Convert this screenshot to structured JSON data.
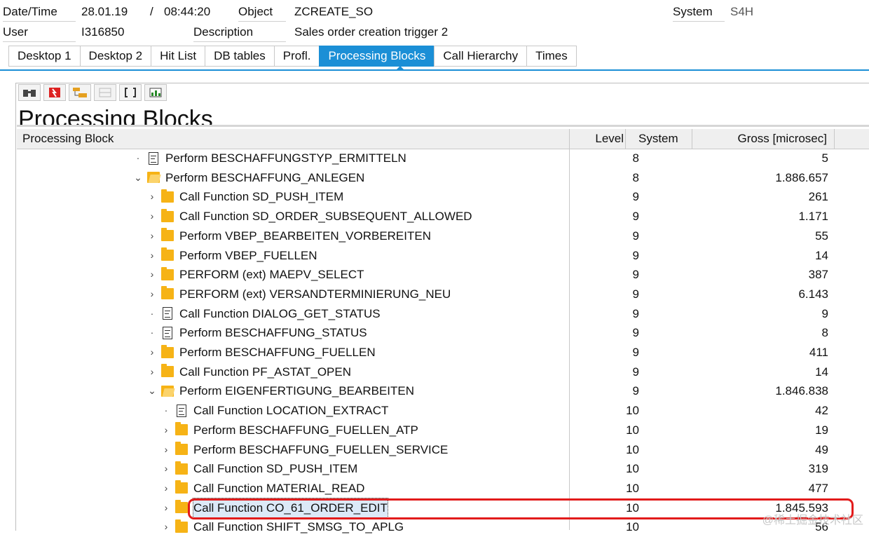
{
  "header": {
    "datetime_label": "Date/Time",
    "date": "28.01.19",
    "slash": "/",
    "time": "08:44:20",
    "object_label": "Object",
    "object": "ZCREATE_SO",
    "system_label": "System",
    "system": "S4H",
    "user_label": "User",
    "user": "I316850",
    "description_label": "Description",
    "description": "Sales order creation trigger 2"
  },
  "tabs": [
    "Desktop 1",
    "Desktop 2",
    "Hit List",
    "DB tables",
    "Profl.",
    "Processing Blocks",
    "Call Hierarchy",
    "Times"
  ],
  "active_tab": "Processing Blocks",
  "toolbar": {
    "icons": [
      "binoculars-icon",
      "delete-icon",
      "hierarchy-icon",
      "layout-icon",
      "bracket-icon",
      "chart-icon"
    ]
  },
  "panel_title": "Processing Blocks",
  "columns": {
    "block": "Processing Block",
    "level": "Level",
    "system": "System",
    "gross": "Gross [microsec]"
  },
  "rows": [
    {
      "indent": 0,
      "expander": "·",
      "icon": "doc",
      "label": "Perform BESCHAFFUNGSTYP_ERMITTELN",
      "level": "8",
      "gross": "5"
    },
    {
      "indent": 0,
      "expander": "⌄",
      "icon": "folder-open",
      "label": "Perform BESCHAFFUNG_ANLEGEN",
      "level": "8",
      "gross": "1.886.657"
    },
    {
      "indent": 1,
      "expander": "›",
      "icon": "folder",
      "label": "Call Function SD_PUSH_ITEM",
      "level": "9",
      "gross": "261"
    },
    {
      "indent": 1,
      "expander": "›",
      "icon": "folder",
      "label": "Call Function SD_ORDER_SUBSEQUENT_ALLOWED",
      "level": "9",
      "gross": "1.171"
    },
    {
      "indent": 1,
      "expander": "›",
      "icon": "folder",
      "label": "Perform VBEP_BEARBEITEN_VORBEREITEN",
      "level": "9",
      "gross": "55"
    },
    {
      "indent": 1,
      "expander": "›",
      "icon": "folder",
      "label": "Perform VBEP_FUELLEN",
      "level": "9",
      "gross": "14"
    },
    {
      "indent": 1,
      "expander": "›",
      "icon": "folder",
      "label": "PERFORM (ext) MAEPV_SELECT",
      "level": "9",
      "gross": "387"
    },
    {
      "indent": 1,
      "expander": "›",
      "icon": "folder",
      "label": "PERFORM (ext) VERSANDTERMINIERUNG_NEU",
      "level": "9",
      "gross": "6.143"
    },
    {
      "indent": 1,
      "expander": "·",
      "icon": "doc",
      "label": "Call Function DIALOG_GET_STATUS",
      "level": "9",
      "gross": "9"
    },
    {
      "indent": 1,
      "expander": "·",
      "icon": "doc",
      "label": "Perform BESCHAFFUNG_STATUS",
      "level": "9",
      "gross": "8"
    },
    {
      "indent": 1,
      "expander": "›",
      "icon": "folder",
      "label": "Perform BESCHAFFUNG_FUELLEN",
      "level": "9",
      "gross": "411"
    },
    {
      "indent": 1,
      "expander": "›",
      "icon": "folder",
      "label": "Call Function PF_ASTAT_OPEN",
      "level": "9",
      "gross": "14"
    },
    {
      "indent": 1,
      "expander": "⌄",
      "icon": "folder-open",
      "label": "Perform EIGENFERTIGUNG_BEARBEITEN",
      "level": "9",
      "gross": "1.846.838"
    },
    {
      "indent": 2,
      "expander": "·",
      "icon": "doc",
      "label": "Call Function LOCATION_EXTRACT",
      "level": "10",
      "gross": "42"
    },
    {
      "indent": 2,
      "expander": "›",
      "icon": "folder",
      "label": "Perform BESCHAFFUNG_FUELLEN_ATP",
      "level": "10",
      "gross": "19"
    },
    {
      "indent": 2,
      "expander": "›",
      "icon": "folder",
      "label": "Perform BESCHAFFUNG_FUELLEN_SERVICE",
      "level": "10",
      "gross": "49"
    },
    {
      "indent": 2,
      "expander": "›",
      "icon": "folder",
      "label": "Call Function SD_PUSH_ITEM",
      "level": "10",
      "gross": "319"
    },
    {
      "indent": 2,
      "expander": "›",
      "icon": "folder",
      "label": "Call Function MATERIAL_READ",
      "level": "10",
      "gross": "477"
    },
    {
      "indent": 2,
      "expander": "›",
      "icon": "folder",
      "label": "Call Function CO_61_ORDER_EDIT",
      "level": "10",
      "gross": "1.845.593",
      "selected": true
    },
    {
      "indent": 2,
      "expander": "›",
      "icon": "folder",
      "label": "Call Function SHIFT_SMSG_TO_APLG",
      "level": "10",
      "gross": "56"
    }
  ],
  "watermark": "@稀土掘金技术社区"
}
